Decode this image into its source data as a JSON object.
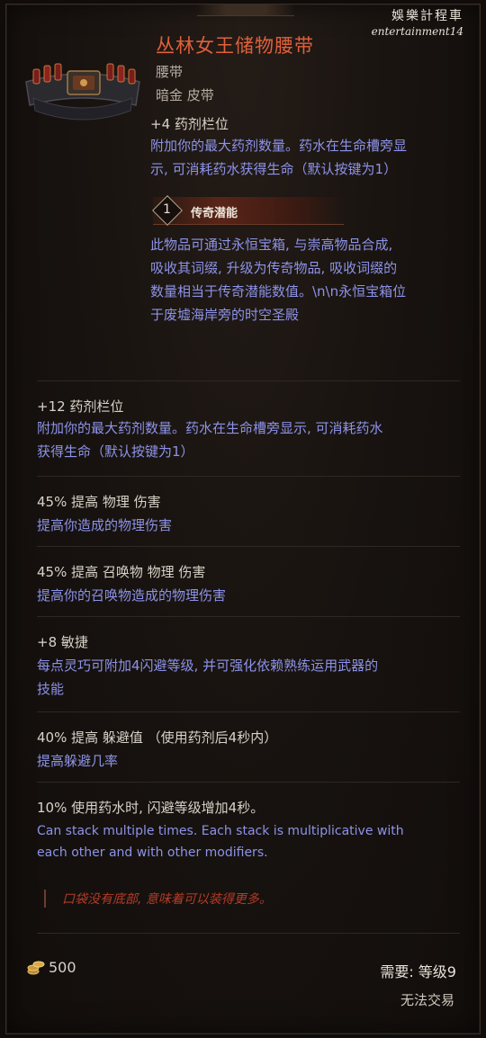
{
  "watermark": {
    "cn": "娛樂計程車",
    "en": "entertainment14"
  },
  "item": {
    "name": "丛林女王储物腰带",
    "type": "腰带",
    "subtype": "暗金 皮带"
  },
  "base_mod": {
    "head": "+4 药剂栏位",
    "desc_line1": "附加你的最大药剂数量。药水在生命槽旁显",
    "desc_line2": "示, 可消耗药水获得生命（默认按键为1）"
  },
  "legendary": {
    "number": "1",
    "label": "传奇潜能",
    "desc_line1": "此物品可通过永恒宝箱, 与崇高物品合成,",
    "desc_line2": "吸收其词缀, 升级为传奇物品, 吸收词缀的",
    "desc_line3": "数量相当于传奇潜能数值。\\n\\n永恒宝箱位",
    "desc_line4": "于废墟海岸旁的时空圣殿"
  },
  "affixes": [
    {
      "head": "+12 药剂栏位",
      "desc_line1": "附加你的最大药剂数量。药水在生命槽旁显示, 可消耗药水",
      "desc_line2": "获得生命（默认按键为1）"
    },
    {
      "head": "45% 提高 物理 伤害",
      "desc_line1": "提高你造成的物理伤害"
    },
    {
      "head": "45% 提高 召唤物 物理 伤害",
      "desc_line1": "提高你的召唤物造成的物理伤害"
    },
    {
      "head": "+8 敏捷",
      "desc_line1": "每点灵巧可附加4闪避等级, 并可强化依赖熟练运用武器的",
      "desc_line2": "技能"
    },
    {
      "head": "40% 提高 躲避值 （使用药剂后4秒内）",
      "desc_line1": "提高躲避几率"
    },
    {
      "head": "10% 使用药水时, 闪避等级增加4秒。",
      "desc_line1": "Can stack multiple times. Each stack is multiplicative with",
      "desc_line2": "each other and with other modifiers."
    }
  ],
  "flavor_text": "口袋没有底部, 意味着可以装得更多。",
  "footer": {
    "gold": "500",
    "requirement": "需要: 等级9",
    "trade": "无法交易"
  }
}
